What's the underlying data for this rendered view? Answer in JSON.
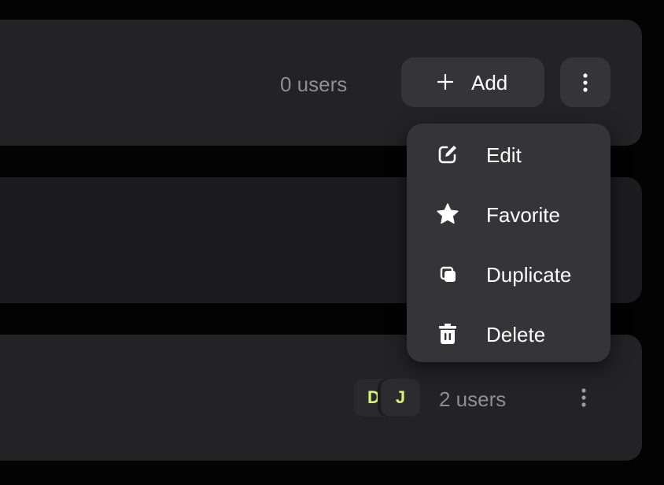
{
  "rows": [
    {
      "user_count": "0 users",
      "add_label": "Add"
    },
    {},
    {
      "avatars": [
        "D",
        "J"
      ],
      "user_count": "2 users"
    }
  ],
  "menu": {
    "items": [
      {
        "label": "Edit",
        "icon": "edit-icon"
      },
      {
        "label": "Favorite",
        "icon": "star-icon"
      },
      {
        "label": "Duplicate",
        "icon": "duplicate-icon"
      },
      {
        "label": "Delete",
        "icon": "trash-icon"
      }
    ]
  },
  "colors": {
    "background": "#030303",
    "card": "#232325",
    "button": "#353537",
    "muted_text": "#8e8e93",
    "avatar_text": "#d7f27a"
  }
}
